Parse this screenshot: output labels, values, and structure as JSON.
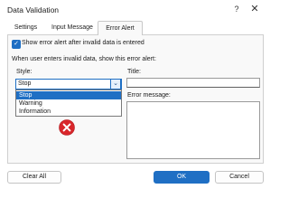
{
  "window": {
    "title": "Data Validation",
    "help_glyph": "?",
    "close_glyph": "✕"
  },
  "tabs": [
    {
      "label": "Settings"
    },
    {
      "label": "Input Message"
    },
    {
      "label": "Error Alert",
      "selected": true
    }
  ],
  "error_alert": {
    "show_alert_checkbox": {
      "label": "Show error alert after invalid data is entered",
      "checked": true
    },
    "section_label": "When user enters invalid data, show this error alert:",
    "style": {
      "label": "Style:",
      "selected": "Stop",
      "arrow_glyph": "⌄",
      "options": [
        "Stop",
        "Warning",
        "Information"
      ],
      "expanded": true
    },
    "title": {
      "label": "Title:",
      "value": ""
    },
    "error_message": {
      "label": "Error message:",
      "value": ""
    },
    "style_icon": "stop-icon"
  },
  "buttons": {
    "clear_all": "Clear All",
    "ok": "OK",
    "cancel": "Cancel"
  },
  "colors": {
    "accent": "#1f6fc4",
    "stop_icon": "#d9262b"
  }
}
